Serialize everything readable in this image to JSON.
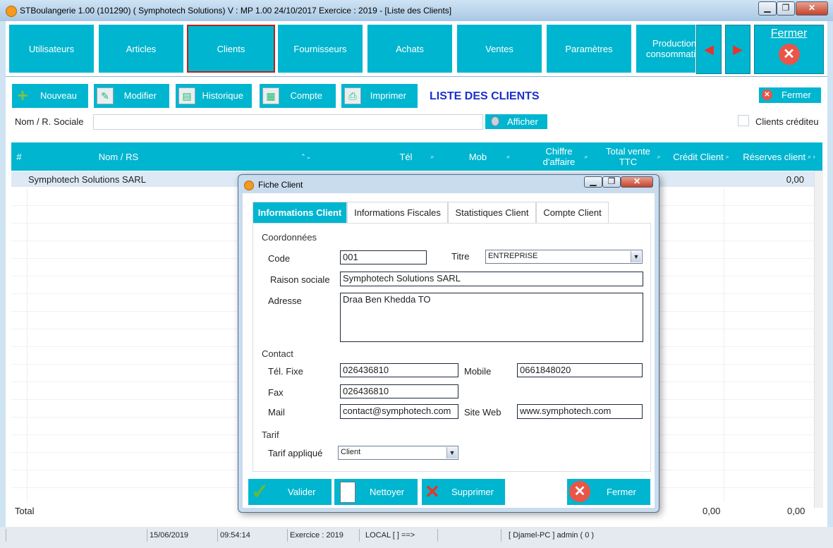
{
  "window": {
    "title": "STBoulangerie 1.00 (101290) ( Symphotech Solutions)  V : MP 1.00 24/10/2017 Exercice : 2019 - [Liste des Clients]",
    "controls": {
      "minimize": "▁",
      "restore": "❐",
      "close": "✕"
    }
  },
  "nav": {
    "tiles": [
      "Utilisateurs",
      "Articles",
      "Clients",
      "Fournisseurs",
      "Achats",
      "Ventes",
      "Paramètres",
      "Production consommation"
    ],
    "active": "Clients",
    "prev": "◀",
    "next": "▶",
    "fermer": "Fermer",
    "fermer_icon": "✕"
  },
  "toolbar": {
    "nouveau": "Nouveau",
    "modifier": "Modifier",
    "historique": "Historique",
    "compte": "Compte",
    "imprimer": "Imprimer",
    "title": "LISTE DES CLIENTS",
    "fermer": "Fermer"
  },
  "search": {
    "label": "Nom / R. Sociale",
    "value": "",
    "afficher": "Afficher",
    "credit_label": "Clients créditeu"
  },
  "table": {
    "columns": [
      "#",
      "Nom / RS",
      "Tél",
      "Mob",
      "Chiffre d'affaire",
      "Total vente TTC",
      "Crédit Client",
      "Réserves client"
    ],
    "rows": [
      {
        "nom": "Symphotech Solutions SARL",
        "reserves": "0,00"
      }
    ],
    "total_label": "Total",
    "totals": [
      "0,00",
      "0,00"
    ]
  },
  "statusbar": [
    "",
    "15/06/2019",
    "09:54:14",
    "Exercice : 2019",
    "LOCAL [  ] ==>",
    "",
    "[ Djamel-PC ] admin ( 0 )"
  ],
  "dialog": {
    "title": "Fiche Client",
    "tabs": [
      "Informations Client",
      "Informations Fiscales",
      "Statistiques Client",
      "Compte Client"
    ],
    "sections": {
      "coord": "Coordonnées",
      "contact": "Contact",
      "tarif": "Tarif"
    },
    "labels": {
      "code": "Code",
      "titre": "Titre",
      "raison": "Raison sociale",
      "adresse": "Adresse",
      "tel": "Tél. Fixe",
      "mobile": "Mobile",
      "fax": "Fax",
      "mail": "Mail",
      "site": "Site Web",
      "tarif": "Tarif appliqué"
    },
    "values": {
      "code": "001",
      "titre": "ENTREPRISE",
      "raison": "Symphotech Solutions SARL",
      "adresse": "Draa Ben Khedda TO",
      "tel": "026436810",
      "mobile": "0661848020",
      "fax": "026436810",
      "mail": "contact@symphotech.com",
      "site": "www.symphotech.com",
      "tarif": "Client"
    },
    "buttons": {
      "valider": "Valider",
      "nettoyer": "Nettoyer",
      "supprimer": "Supprimer",
      "fermer": "Fermer"
    }
  },
  "colors": {
    "accent": "#00b5cf",
    "title_blue": "#1a2fcf",
    "red": "#e95548"
  }
}
